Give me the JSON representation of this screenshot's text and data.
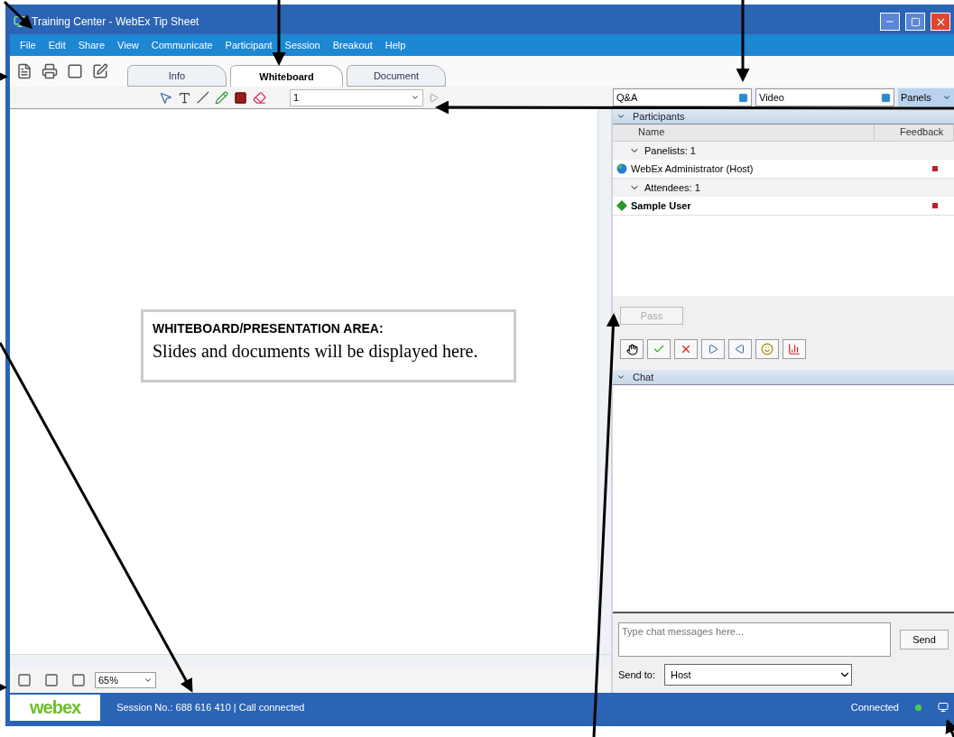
{
  "window": {
    "title": "Training Center - WebEx Tip Sheet"
  },
  "menu": [
    "File",
    "Edit",
    "Share",
    "View",
    "Communicate",
    "Participant",
    "Session",
    "Breakout",
    "Help"
  ],
  "tabs": [
    {
      "label": "Info",
      "selected": false
    },
    {
      "label": "Whiteboard",
      "selected": true
    },
    {
      "label": "Document",
      "selected": false
    }
  ],
  "annotation_toolbar": {
    "page": "1"
  },
  "panel_selectors": [
    {
      "label": "Q&A",
      "kind": "field"
    },
    {
      "label": "Video",
      "kind": "field"
    },
    {
      "label": "Panels",
      "kind": "menu"
    }
  ],
  "callout": {
    "heading": "WHITEBOARD/PRESENTATION AREA:",
    "body": "Slides and documents will be displayed here."
  },
  "zoom": "65%",
  "participants": {
    "title": "Participants",
    "columns": [
      "Name",
      "Feedback"
    ],
    "groups": [
      {
        "label": "Panelists: 1",
        "expanded": true,
        "members": [
          {
            "name": "WebEx Administrator (Host)",
            "kind": "host",
            "feedback": true
          }
        ]
      },
      {
        "label": "Attendees: 1",
        "expanded": true,
        "members": [
          {
            "name": "Sample User",
            "kind": "attendee",
            "feedback": true
          }
        ]
      }
    ]
  },
  "pass_button": {
    "label": "Pass",
    "disabled": true
  },
  "chat": {
    "title": "Chat",
    "placeholder": "Type chat messages here...",
    "send": "Send",
    "send_to_label": "Send to:",
    "send_to": "Host"
  },
  "status_bar": {
    "logo": "webex",
    "session": "Session No.: 688 616 410 | Call connected",
    "connection": "Connected"
  }
}
